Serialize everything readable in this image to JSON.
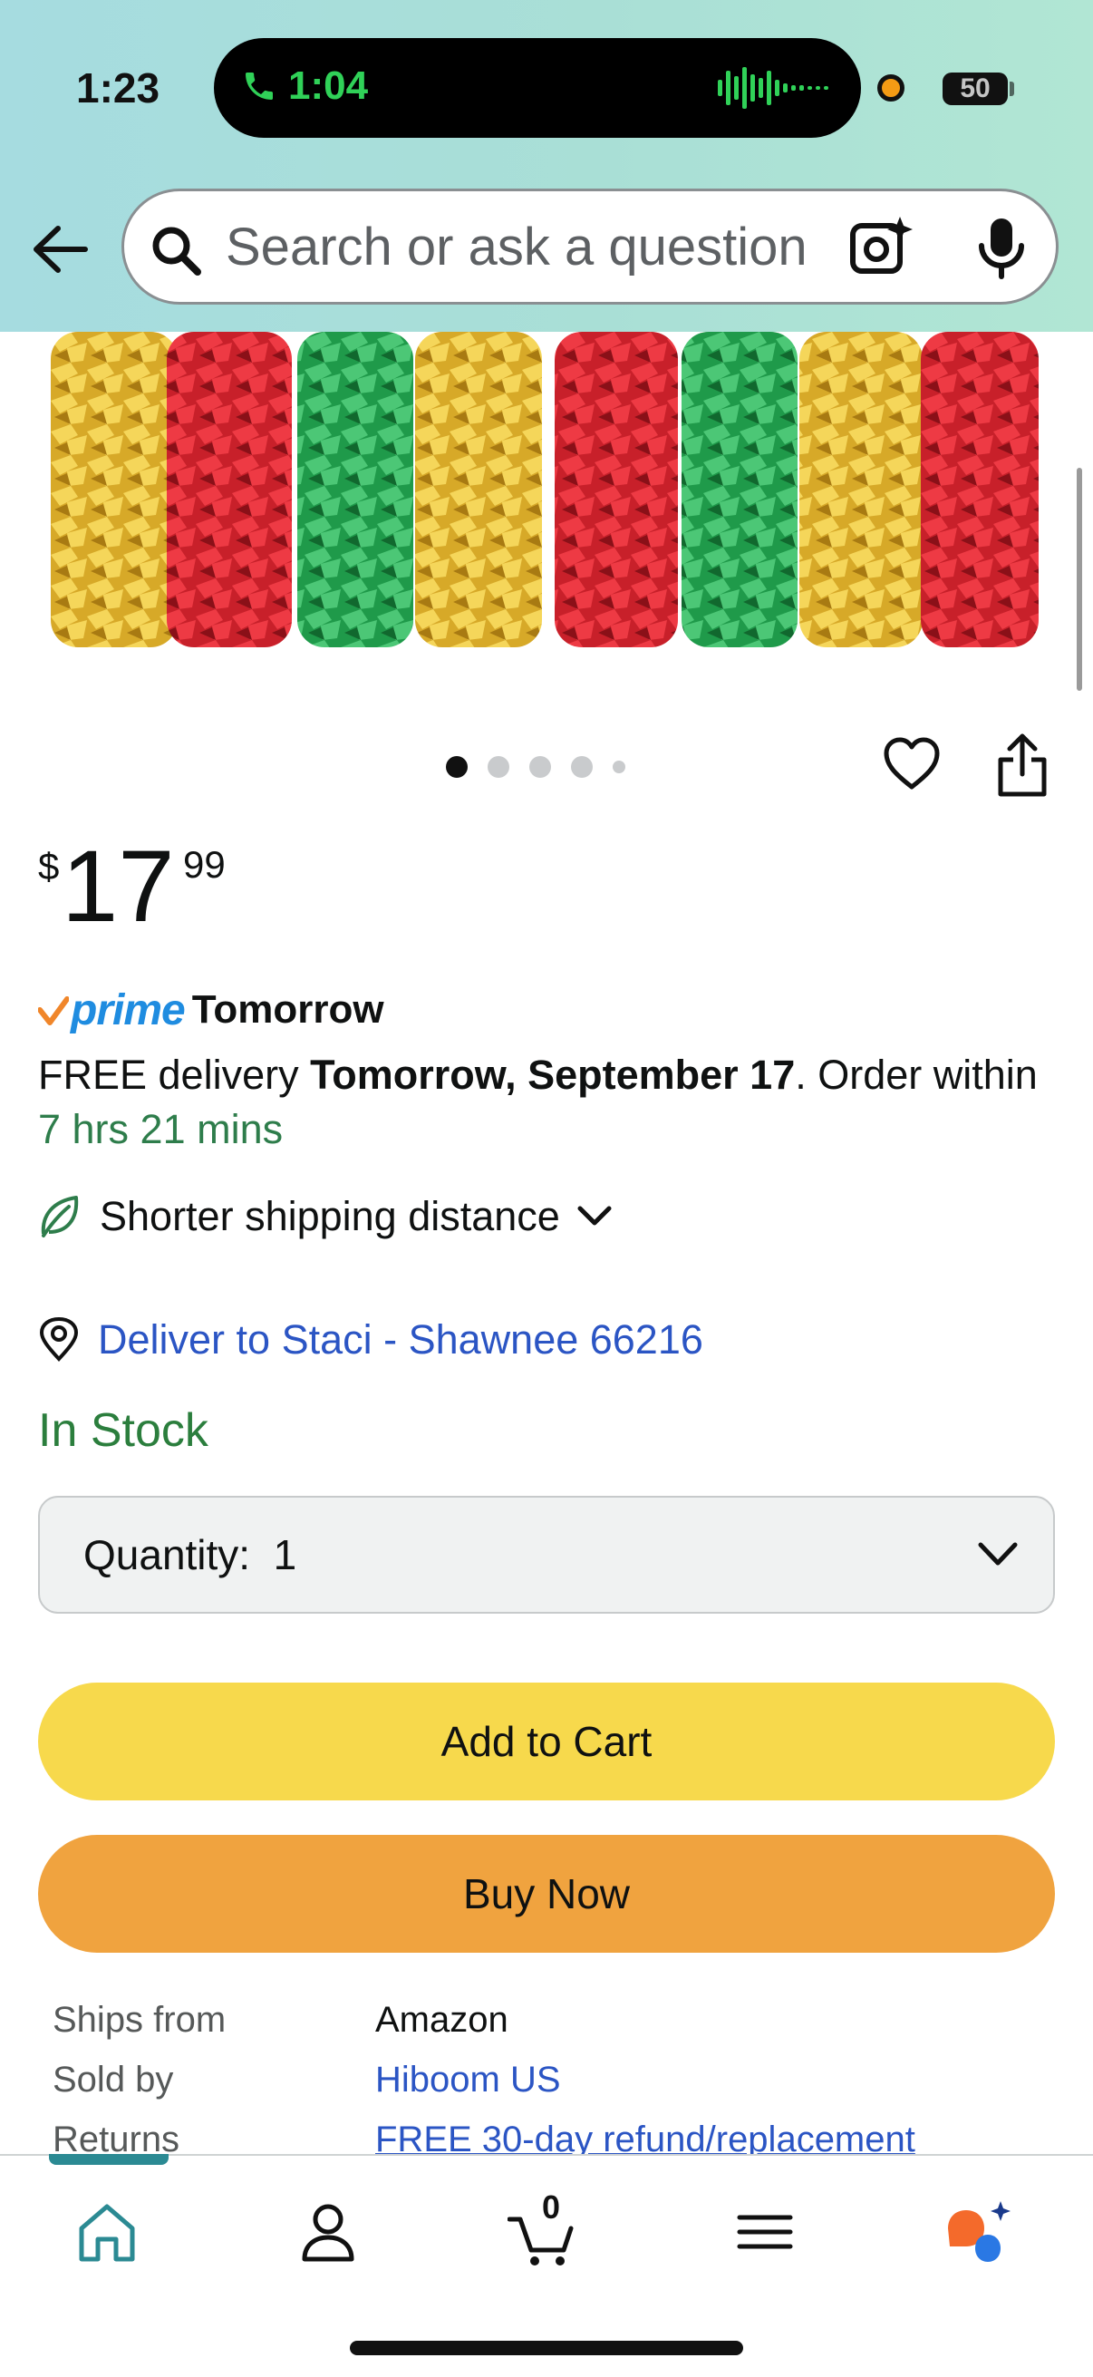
{
  "status_bar": {
    "time": "1:23",
    "call_time": "1:04",
    "battery": "50"
  },
  "search": {
    "placeholder": "Search or ask a question"
  },
  "price": {
    "symbol": "$",
    "whole": "17",
    "fraction": "99"
  },
  "prime": {
    "brand": "prime",
    "day": "Tomorrow"
  },
  "delivery": {
    "prefix": "FREE delivery ",
    "date": "Tomorrow, September 17",
    "middle": ". Order within ",
    "countdown": "7 hrs 21 mins"
  },
  "shipping_distance": {
    "label": "Shorter shipping distance"
  },
  "deliver_to": {
    "label": "Deliver to Staci - Shawnee 66216"
  },
  "stock": {
    "label": "In Stock"
  },
  "quantity": {
    "label": "Quantity:",
    "value": "1"
  },
  "buttons": {
    "add_to_cart": "Add to Cart",
    "buy_now": "Buy Now"
  },
  "info": {
    "ships_from_key": "Ships from",
    "ships_from_val": "Amazon",
    "sold_by_key": "Sold by",
    "sold_by_val": "Hiboom US",
    "returns_key": "Returns",
    "returns_val": "FREE 30-day refund/replacement"
  },
  "carousel": {
    "count": 5,
    "active_index": 0
  },
  "nav": {
    "cart_count": "0"
  },
  "colors": {
    "accent_teal": "#2b8a93",
    "link_blue": "#2b55c4",
    "stock_green": "#2b7e3d",
    "cart_yellow": "#f7d94c",
    "buy_orange": "#f0a33f",
    "prime_blue": "#1f8ce0"
  }
}
